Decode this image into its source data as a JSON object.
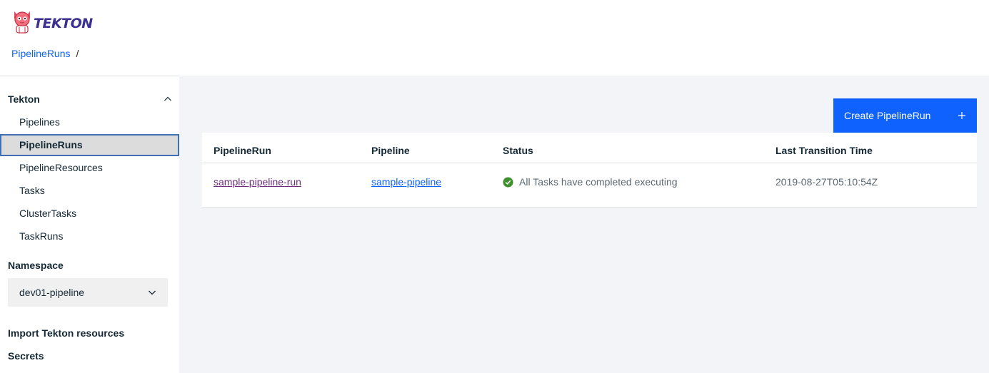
{
  "header": {
    "logo_text": "TEKTON",
    "breadcrumb": {
      "root": "PipelineRuns",
      "separator": "/"
    }
  },
  "sidebar": {
    "section_title": "Tekton",
    "items": [
      {
        "label": "Pipelines",
        "active": false
      },
      {
        "label": "PipelineRuns",
        "active": true
      },
      {
        "label": "PipelineResources",
        "active": false
      },
      {
        "label": "Tasks",
        "active": false
      },
      {
        "label": "ClusterTasks",
        "active": false
      },
      {
        "label": "TaskRuns",
        "active": false
      }
    ],
    "namespace_label": "Namespace",
    "namespace_value": "dev01-pipeline",
    "import_link": "Import Tekton resources",
    "secrets_link": "Secrets"
  },
  "main": {
    "create_button": {
      "label": "Create PipelineRun",
      "icon": "plus-icon"
    },
    "table": {
      "headers": [
        "PipelineRun",
        "Pipeline",
        "Status",
        "Last Transition Time"
      ],
      "rows": [
        {
          "pipelinerun": "sample-pipeline-run",
          "pipeline": "sample-pipeline",
          "status": "All Tasks have completed executing",
          "status_icon": "checkmark-circle-icon",
          "time": "2019-08-27T05:10:54Z"
        }
      ]
    }
  },
  "colors": {
    "accent": "#0f62fe",
    "success": "#3f8f2f",
    "visited_link": "#6b2f7c",
    "main_bg": "#f2f4f8"
  }
}
